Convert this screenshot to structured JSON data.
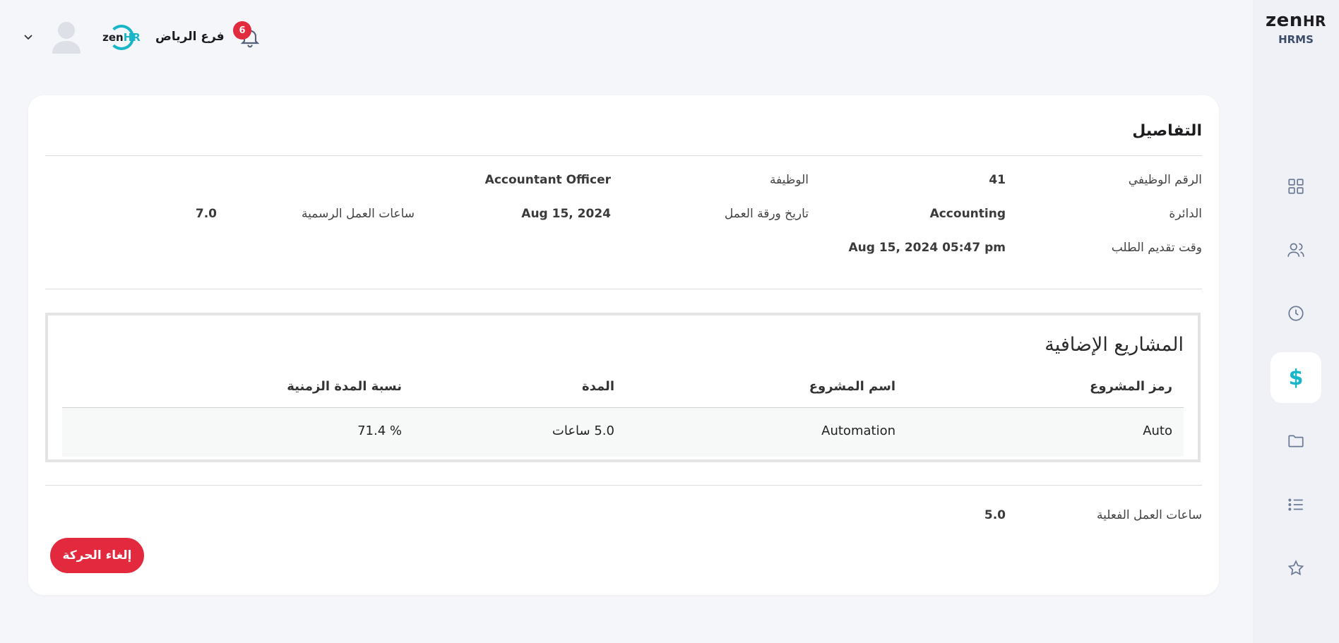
{
  "sidebar": {
    "brand": "zen",
    "brand_hr": "HR",
    "brand_sub": "HRMS",
    "items": [
      {
        "icon": "grid-icon"
      },
      {
        "icon": "users-icon"
      },
      {
        "icon": "clock-icon"
      },
      {
        "icon": "dollar-icon",
        "glyph": "$",
        "active": true
      },
      {
        "icon": "folder-icon"
      },
      {
        "icon": "list-icon"
      },
      {
        "icon": "star-icon"
      }
    ]
  },
  "header": {
    "branch": "فرع الرياض",
    "logo_text": "zen",
    "logo_hr": "HR",
    "notifications": "6"
  },
  "details": {
    "title": "التفاصيل",
    "employee_id_label": "الرقم الوظيفي",
    "employee_id": "41",
    "job_label": "الوظيفة",
    "job": "Accountant Officer",
    "department_label": "الدائرة",
    "department": "Accounting",
    "timesheet_date_label": "تاريخ ورقة العمل",
    "timesheet_date": "Aug 15, 2024",
    "official_hours_label": "ساعات العمل الرسمية",
    "official_hours": "7.0",
    "submitted_label": "وقت تقديم الطلب",
    "submitted": "Aug 15, 2024 05:47 pm"
  },
  "projects": {
    "title": "المشاريع الإضافية",
    "columns": [
      "رمز المشروع",
      "اسم المشروع",
      "المدة",
      "نسبة المدة الزمنية"
    ],
    "rows": [
      {
        "code": "Auto",
        "name": "Automation",
        "duration": "5.0 ساعات",
        "ratio": "71.4 %"
      }
    ]
  },
  "actual_hours_label": "ساعات العمل الفعلية",
  "actual_hours": "5.0",
  "cancel_button": "إلغاء الحركة",
  "colors": {
    "accent": "#18b6c8",
    "danger": "#e3293e",
    "background": "#f5f6fa"
  }
}
